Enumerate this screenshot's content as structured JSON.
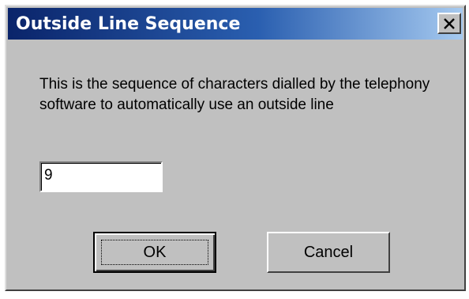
{
  "dialog": {
    "title": "Outside Line Sequence",
    "close_icon": "close-icon",
    "message": "This is the sequence of characters dialled by the telephony software to automatically use an outside line",
    "input_value": "9",
    "ok_label": "OK",
    "cancel_label": "Cancel"
  },
  "colors": {
    "titlebar_start": "#0a246a",
    "titlebar_end": "#a6caf0",
    "dialog_bg": "#c0c0c0"
  }
}
